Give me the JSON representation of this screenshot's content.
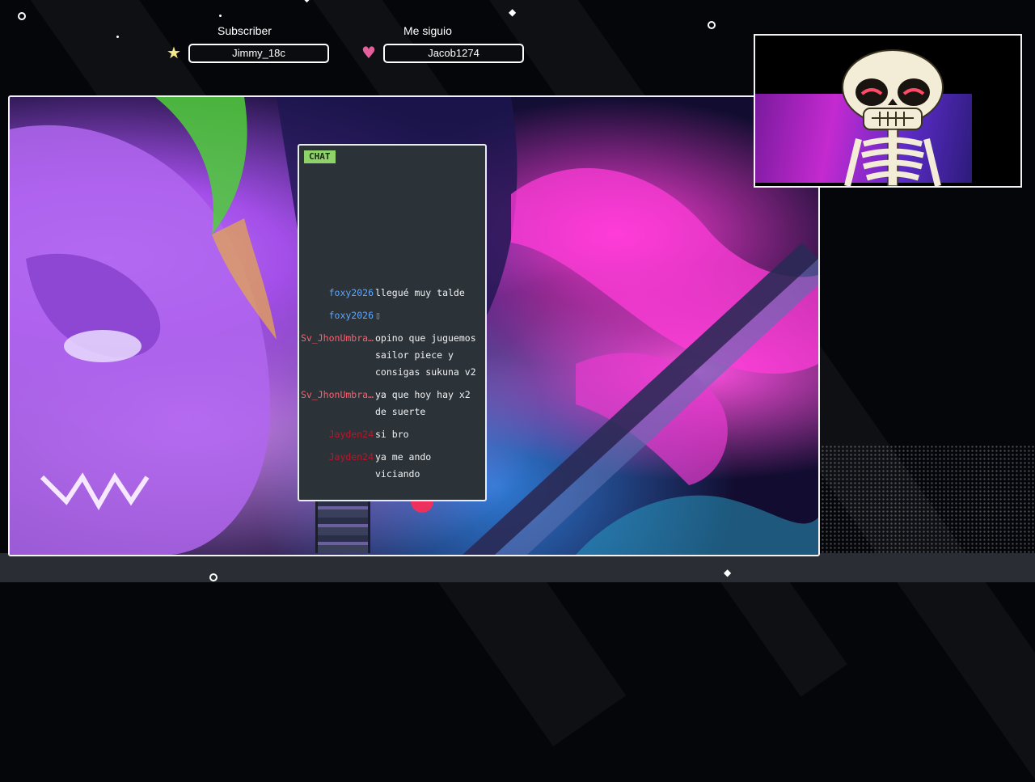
{
  "alerts": {
    "subscriber": {
      "title": "Subscriber",
      "name": "Jimmy_18c",
      "icon": "star-icon",
      "icon_color": "#f5e78c"
    },
    "follower": {
      "title": "Me siguio",
      "name": "Jacob1274",
      "icon": "heart-icon",
      "icon_color": "#e55f9a"
    }
  },
  "chat": {
    "label": "CHAT",
    "messages": [
      {
        "user": "foxy2026",
        "user_color": "#5ea7ff",
        "text": "llegué muy talde"
      },
      {
        "user": "foxy2026",
        "user_color": "#5ea7ff",
        "text": "▯"
      },
      {
        "user": "Sv_JhonUmbra…",
        "user_color": "#ff5f6e",
        "text": "opino que juguemos sailor piece y consigas sukuna v2"
      },
      {
        "user": "Sv_JhonUmbra…",
        "user_color": "#ff5f6e",
        "text": "ya que hoy hay x2 de suerte"
      },
      {
        "user": "Jayden24",
        "user_color": "#c0142a",
        "text": "si bro"
      },
      {
        "user": "Jayden24",
        "user_color": "#c0142a",
        "text": "ya me ando viciando"
      }
    ]
  },
  "webcam": {
    "avatar": "skeleton-avatar"
  },
  "colors": {
    "accent_chat_tag": "#8fd26a",
    "chat_bg": "#2b3238",
    "frame_border": "#f2f2f2"
  }
}
